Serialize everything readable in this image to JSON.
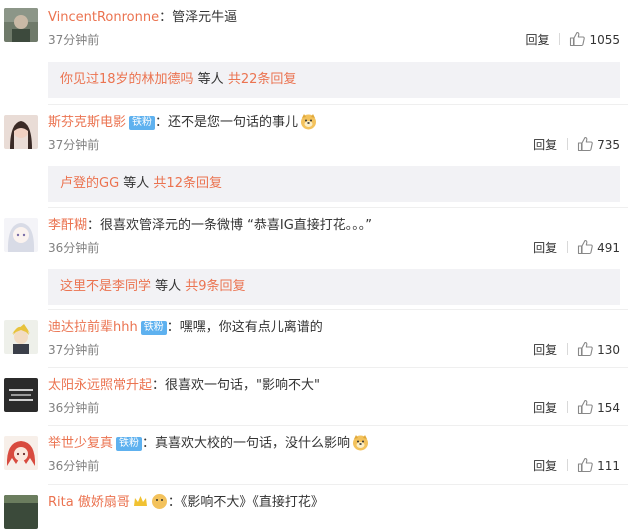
{
  "comments": [
    {
      "username": "VincentRonronne",
      "badge": "",
      "colon": "：",
      "text": "管泽元牛逼",
      "has_emoji": false,
      "time": "37分钟前",
      "reply_label": "回复",
      "likes": "1055",
      "more": {
        "user": "你见过18岁的林加德吗",
        "mid": " 等人 ",
        "count": "共22条回复"
      }
    },
    {
      "username": "斯芬克斯电影",
      "badge": "铁粉",
      "colon": "：",
      "text": "还不是您一句话的事儿",
      "has_emoji": true,
      "time": "37分钟前",
      "reply_label": "回复",
      "likes": "735",
      "more": {
        "user": "卢登的GG",
        "mid": " 等人 ",
        "count": "共12条回复"
      }
    },
    {
      "username": "李酐糊",
      "badge": "",
      "colon": "：",
      "text": "很喜欢管泽元的一条微博 “恭喜IG直接打花。。。”",
      "has_emoji": false,
      "time": "36分钟前",
      "reply_label": "回复",
      "likes": "491",
      "more": {
        "user": "这里不是李同学",
        "mid": " 等人 ",
        "count": "共9条回复"
      }
    },
    {
      "username": "迪达拉前辈hhh",
      "badge": "铁粉",
      "colon": "：",
      "text": "嘿嘿，你这有点儿离谱的",
      "has_emoji": false,
      "time": "37分钟前",
      "reply_label": "回复",
      "likes": "130"
    },
    {
      "username": "太阳永远照常升起",
      "badge": "",
      "colon": "：",
      "text": "很喜欢一句话，\"影响不大\"",
      "has_emoji": false,
      "time": "36分钟前",
      "reply_label": "回复",
      "likes": "154"
    },
    {
      "username": "举世少复真",
      "badge": "铁粉",
      "colon": "：",
      "text": "真喜欢大校的一句话，没什么影响",
      "has_emoji": true,
      "time": "36分钟前",
      "reply_label": "回复",
      "likes": "111"
    },
    {
      "username": "Rita",
      "badge": "",
      "colon": "",
      "text": "傲娇扇哥",
      "has_emoji": false,
      "tail": "：《影响不大》《直接打花》",
      "time": "",
      "reply_label": "",
      "likes": ""
    }
  ],
  "colors": {
    "username": "#eb7350",
    "badge": "#5eb1ef",
    "more_bg": "#f2f2f5",
    "time": "#808080"
  }
}
